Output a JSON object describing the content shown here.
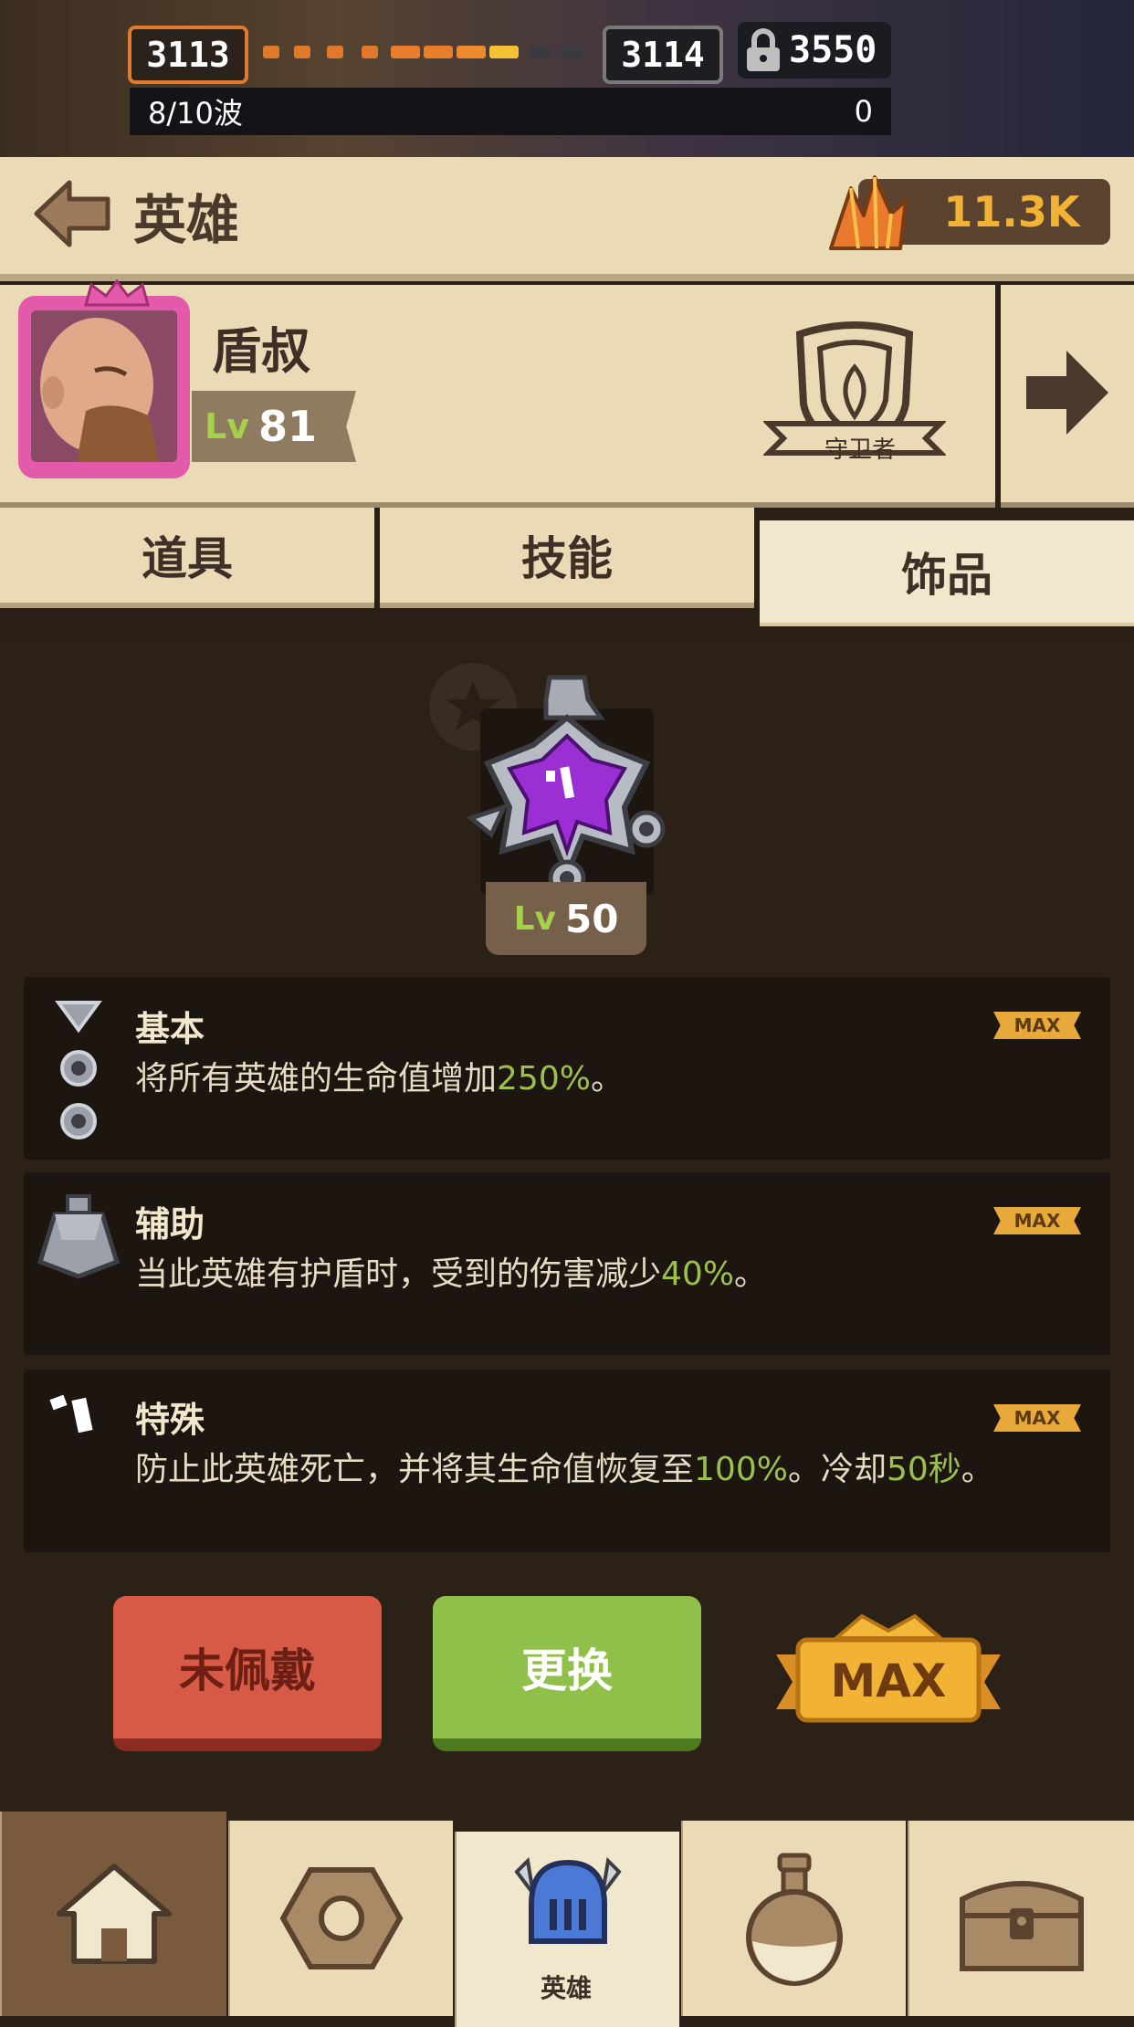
{
  "top": {
    "stage_current": "3113",
    "stage_next": "3114",
    "locked_stage": "3550",
    "wave": "8/10波",
    "wave_right_value": "0"
  },
  "header": {
    "title": "英雄",
    "currency_value": "11.3K"
  },
  "hero": {
    "name": "盾叔",
    "level_prefix": "Lv",
    "level": "81",
    "role": "守卫者"
  },
  "tabs": [
    {
      "label": "道具"
    },
    {
      "label": "技能"
    },
    {
      "label": "饰品"
    }
  ],
  "gem": {
    "level_prefix": "Lv",
    "level": "50"
  },
  "slots": [
    {
      "title": "基本",
      "desc_prefix": "将所有英雄的生命值增加",
      "desc_value": "250%",
      "desc_suffix": "。",
      "badge": "MAX"
    },
    {
      "title": "辅助",
      "desc_prefix": "当此英雄有护盾时，受到的伤害减少",
      "desc_value": "40%",
      "desc_suffix": "。",
      "badge": "MAX"
    },
    {
      "title": "特殊",
      "desc_prefix": "防止此英雄死亡，并将其生命值恢复至",
      "desc_value": "100%",
      "desc_mid": "。冷却",
      "desc_value2": "50秒",
      "desc_suffix": "。",
      "badge": "MAX"
    }
  ],
  "buttons": {
    "unequipped": "未佩戴",
    "replace": "更换",
    "max": "MAX"
  },
  "nav": {
    "active_label": "英雄"
  },
  "colors": {
    "accent_green": "#9bc14a",
    "currency_orange": "#f2b233",
    "button_red": "#d65a46",
    "button_green": "#8fc04a",
    "panel_bg": "#2c2117",
    "paper": "#eadbb6"
  }
}
